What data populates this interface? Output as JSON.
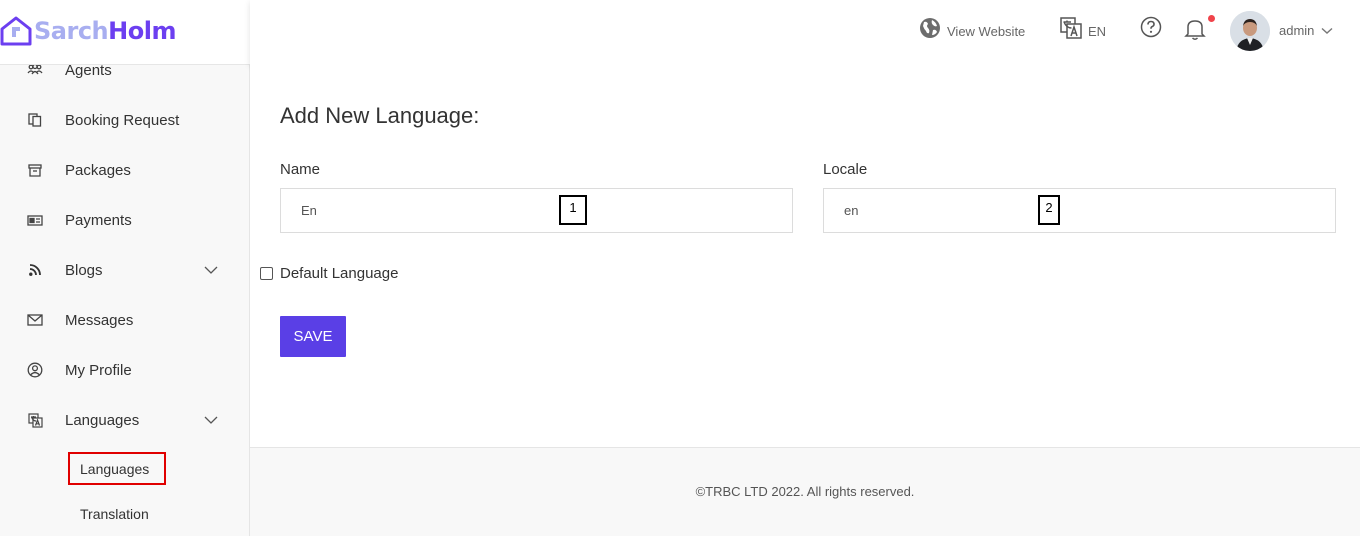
{
  "brand": {
    "name_part1": "Sarch",
    "name_part2": "Holm",
    "color_light": "#a8aef0",
    "color_dark": "#6c3ff0"
  },
  "sidebar": {
    "items": [
      {
        "label": "Agents",
        "icon": "agents-icon"
      },
      {
        "label": "Booking Request",
        "icon": "copy-icon"
      },
      {
        "label": "Packages",
        "icon": "archive-box-icon"
      },
      {
        "label": "Payments",
        "icon": "payment-card-icon"
      },
      {
        "label": "Blogs",
        "icon": "rss-feed-icon",
        "expandable": true
      },
      {
        "label": "Messages",
        "icon": "envelope-icon"
      },
      {
        "label": "My Profile",
        "icon": "user-circle-icon"
      },
      {
        "label": "Languages",
        "icon": "translate-icon",
        "expandable": true
      }
    ],
    "sub_items": [
      {
        "label": "Languages",
        "active": true
      },
      {
        "label": "Translation",
        "active": false
      }
    ]
  },
  "topbar": {
    "view_website": "View Website",
    "language": "EN",
    "user": "admin",
    "icons": [
      "globe-icon",
      "translate-icon",
      "help-circle-icon",
      "bell-icon",
      "caret-down-icon"
    ],
    "notification_dot_color": "#f0434a"
  },
  "form": {
    "title": "Add New Language:",
    "name_label": "Name",
    "name_value": "En",
    "name_marker": "1",
    "locale_label": "Locale",
    "locale_value": "en",
    "locale_marker": "2",
    "default_label": "Default Language",
    "default_checked": false,
    "save_label": "SAVE",
    "save_color": "#5a3fe6"
  },
  "footer": {
    "text": "©TRBC LTD 2022. All rights reserved."
  }
}
